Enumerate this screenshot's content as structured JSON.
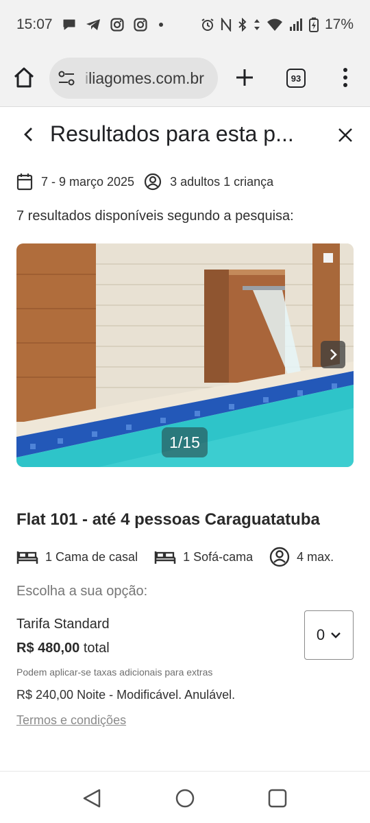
{
  "status_bar": {
    "time": "15:07",
    "battery_percent": "17%",
    "notification_icons": [
      "chat-bubble-icon",
      "telegram-icon",
      "instagram-icon",
      "instagram-icon",
      "dot-icon"
    ],
    "system_icons": [
      "alarm-icon",
      "nfc-icon",
      "bluetooth-icon",
      "data-arrows-icon",
      "wifi-icon",
      "signal-icon",
      "battery-icon"
    ]
  },
  "browser": {
    "url_faded": "i",
    "url": "liagomes.com.br",
    "tab_count": "93"
  },
  "header": {
    "title": "Resultados para esta p..."
  },
  "search": {
    "dates": "7 - 9 março 2025",
    "guests": "3 adultos 1 criança",
    "results_text": "7 resultados disponíveis segundo a pesquisa:"
  },
  "gallery": {
    "counter": "1/15"
  },
  "listing": {
    "title": "Flat 101 - até 4 pessoas Caraguatatuba",
    "amenities": [
      {
        "icon": "bed-icon",
        "label": "1 Cama de casal"
      },
      {
        "icon": "bed-icon",
        "label": "1 Sofá-cama"
      },
      {
        "icon": "person-icon",
        "label": "4 max."
      }
    ],
    "choose_label": "Escolha a sua opção:",
    "rate": {
      "name": "Tarifa Standard",
      "price": "R$ 480,00",
      "price_suffix": " total",
      "quantity": "0",
      "taxes_note": "Podem aplicar-se taxas adicionais para extras",
      "nightly": "R$ 240,00 Noite - Modificável. Anulável.",
      "terms": "Termos e condições"
    }
  },
  "colors": {
    "pool_water": "#2ec4c9",
    "tile_blue": "#2358b8",
    "wood": "#b06d3c",
    "stone_wall": "#e8e1d3"
  }
}
